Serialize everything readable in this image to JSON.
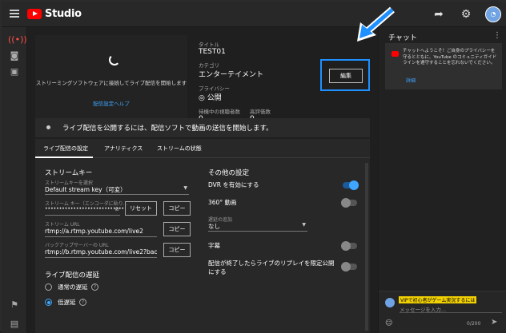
{
  "brand": {
    "studio": "Studio"
  },
  "preview": {
    "message": "ストリーミングソフトウェアに接続してライブ配信を開始します",
    "help": "配信設定ヘルプ"
  },
  "info": {
    "title_label": "タイトル",
    "title": "TEST01",
    "category_label": "カテゴリ",
    "category": "エンターテイメント",
    "privacy_label": "プライバシー",
    "privacy": "公開",
    "waiting_label": "待機中の視聴者数",
    "waiting": "0",
    "likes_label": "高評価数",
    "likes": "0",
    "edit": "編集"
  },
  "notice": "ライブ配信を公開するには、配信ソフトで動画の送信を開始します。",
  "tabs": [
    {
      "label": "ライブ配信の設定"
    },
    {
      "label": "アナリティクス"
    },
    {
      "label": "ストリームの状態"
    }
  ],
  "stream_key": {
    "section": "ストリームキー",
    "select_label": "ストリームキーを選択",
    "select_value": "Default stream key（可変）",
    "key_label": "ストリーム キー（エンコーダに貼り...",
    "key_value": "••••••••••••••••••••••••••••",
    "reset": "リセット",
    "copy": "コピー",
    "url_label": "ストリーム URL",
    "url": "rtmp://a.rtmp.youtube.com/live2",
    "backup_label": "バックアップサーバーの URL",
    "backup": "rtmp://b.rtmp.youtube.com/live2?backup=1"
  },
  "latency": {
    "section": "ライブ配信の遅延",
    "normal": "通常の遅延",
    "low": "低遅延"
  },
  "other": {
    "section": "その他の設定",
    "dvr": "DVR を有効にする",
    "vr360": "360° 動画",
    "delay_label": "遅延の追加",
    "delay_value": "なし",
    "captions": "字幕",
    "replay": "配信が終了したらライブのリプレイを限定公開にする"
  },
  "chat": {
    "title": "チャット",
    "welcome": "チャットへようこそ！ご自身のプライバシーを守るとともに、YouTube のコミュニティガイドラインを遵守することを忘れないでください。",
    "details": "詳細",
    "user": "VIPで初心者がゲーム実況するには",
    "placeholder": "メッセージを入力...",
    "count": "0/200"
  }
}
